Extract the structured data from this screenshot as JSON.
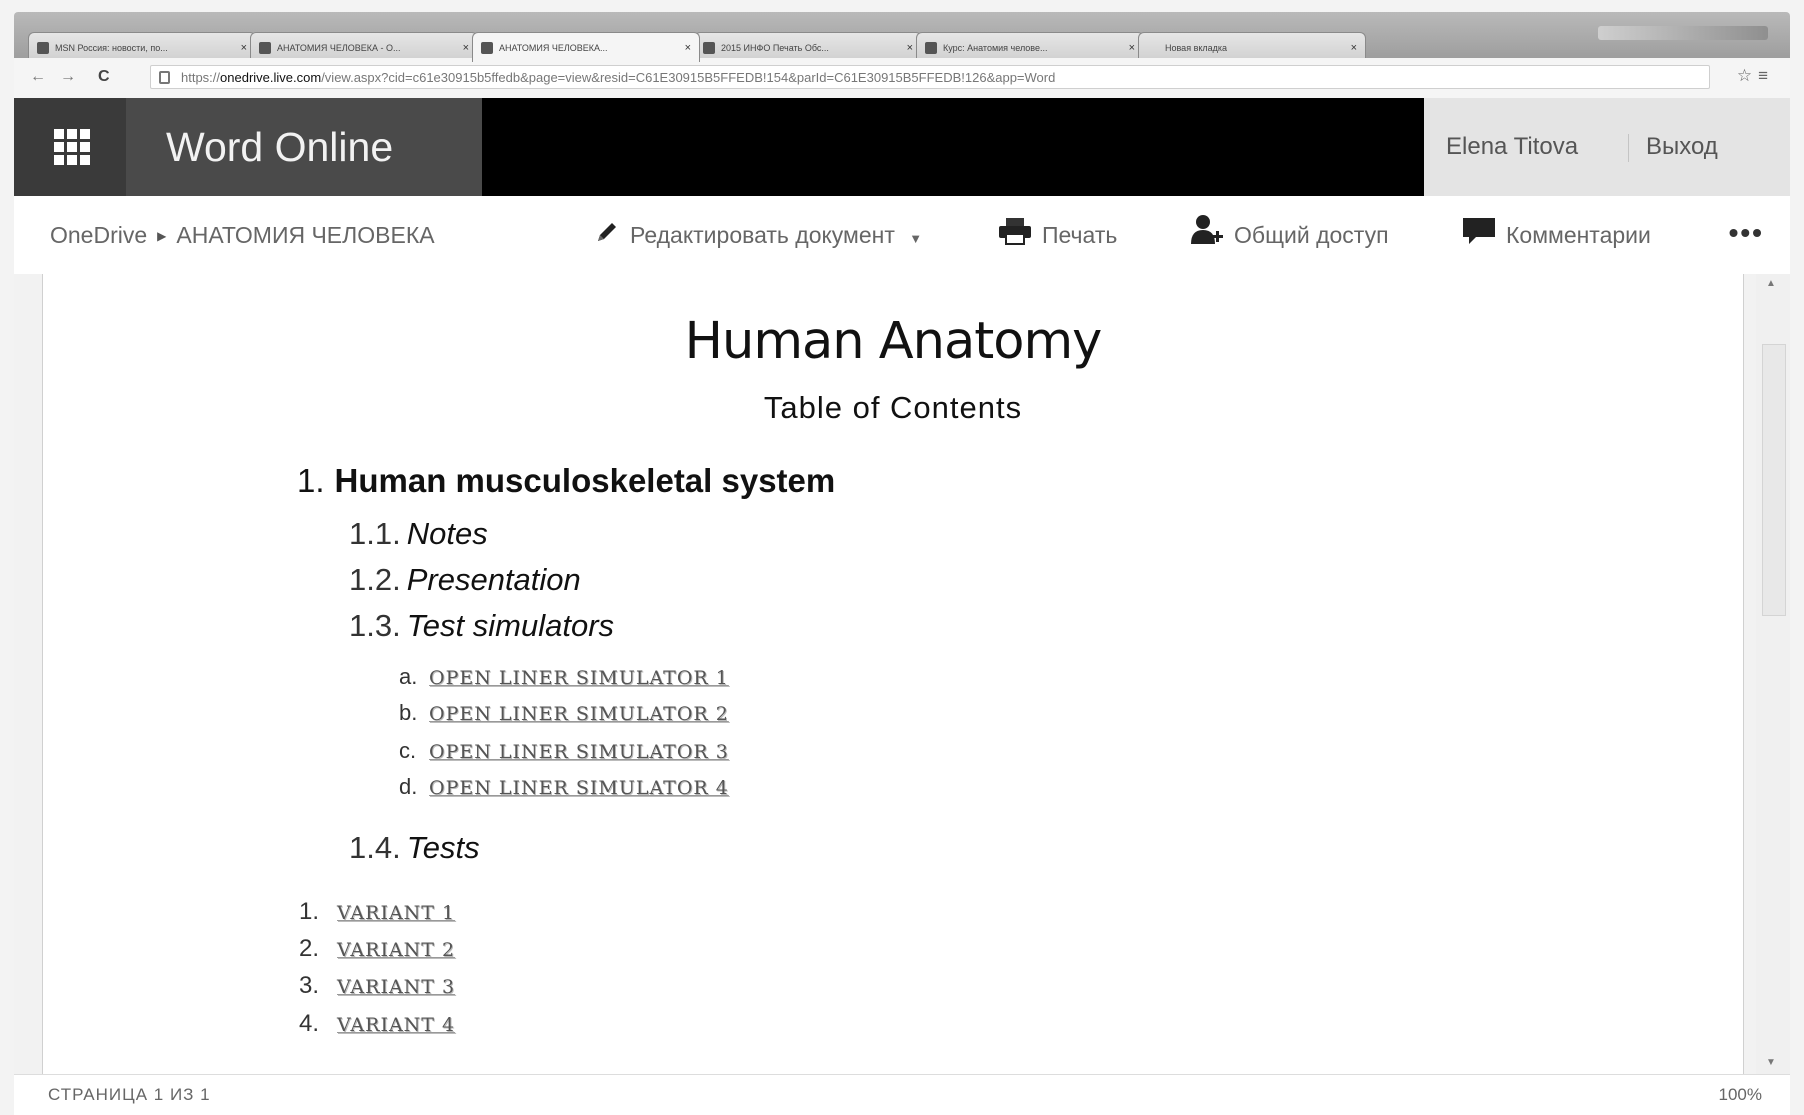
{
  "browser": {
    "tabs": [
      {
        "label": "MSN Россия: новости, по..."
      },
      {
        "label": "АНАТОМИЯ ЧЕЛОВЕКА - O..."
      },
      {
        "label": "АНАТОМИЯ ЧЕЛОВЕКА..."
      },
      {
        "label": "2015 ИНФО Печать Обс..."
      },
      {
        "label": "Курс: Анатомия челове..."
      },
      {
        "label": "Новая вкладка"
      }
    ],
    "url_prefix": "https://",
    "url_host": "onedrive.live.com",
    "url_path": "/view.aspx?cid=c61e30915b5ffedb&page=view&resid=C61E30915B5FFEDB!154&parId=C61E30915B5FFEDB!126&app=Word"
  },
  "app": {
    "brand": "Word Online",
    "user_name": "Elena Titova",
    "logout_label": "Выход"
  },
  "commandbar": {
    "breadcrumb_root": "OneDrive",
    "breadcrumb_doc": "АНАТОМИЯ ЧЕЛОВЕКА",
    "edit_label": "Редактировать документ",
    "print_label": "Печать",
    "share_label": "Общий доступ",
    "comments_label": "Комментарии",
    "more_label": "•••"
  },
  "document": {
    "title": "Human Anatomy",
    "subtitle": "Table of Contents",
    "section": {
      "num": "1.",
      "text": "Human musculoskeletal system"
    },
    "subsections": [
      {
        "num": "1.1.",
        "text": "Notes"
      },
      {
        "num": "1.2.",
        "text": "Presentation"
      },
      {
        "num": "1.3.",
        "text": "Test simulators"
      },
      {
        "num": "1.4.",
        "text": "Tests"
      }
    ],
    "simulators": [
      {
        "num": "a.",
        "text": "OPEN LINER SIMULATOR 1"
      },
      {
        "num": "b.",
        "text": "OPEN LINER SIMULATOR 2"
      },
      {
        "num": "c.",
        "text": "OPEN LINER SIMULATOR 3"
      },
      {
        "num": "d.",
        "text": "OPEN LINER SIMULATOR 4"
      }
    ],
    "variants": [
      {
        "num": "1.",
        "text": "VARIANT 1"
      },
      {
        "num": "2.",
        "text": "VARIANT 2"
      },
      {
        "num": "3.",
        "text": "VARIANT 3"
      },
      {
        "num": "4.",
        "text": "VARIANT 4"
      }
    ]
  },
  "status": {
    "page_info": "СТРАНИЦА 1 ИЗ 1",
    "zoom": "100%"
  }
}
